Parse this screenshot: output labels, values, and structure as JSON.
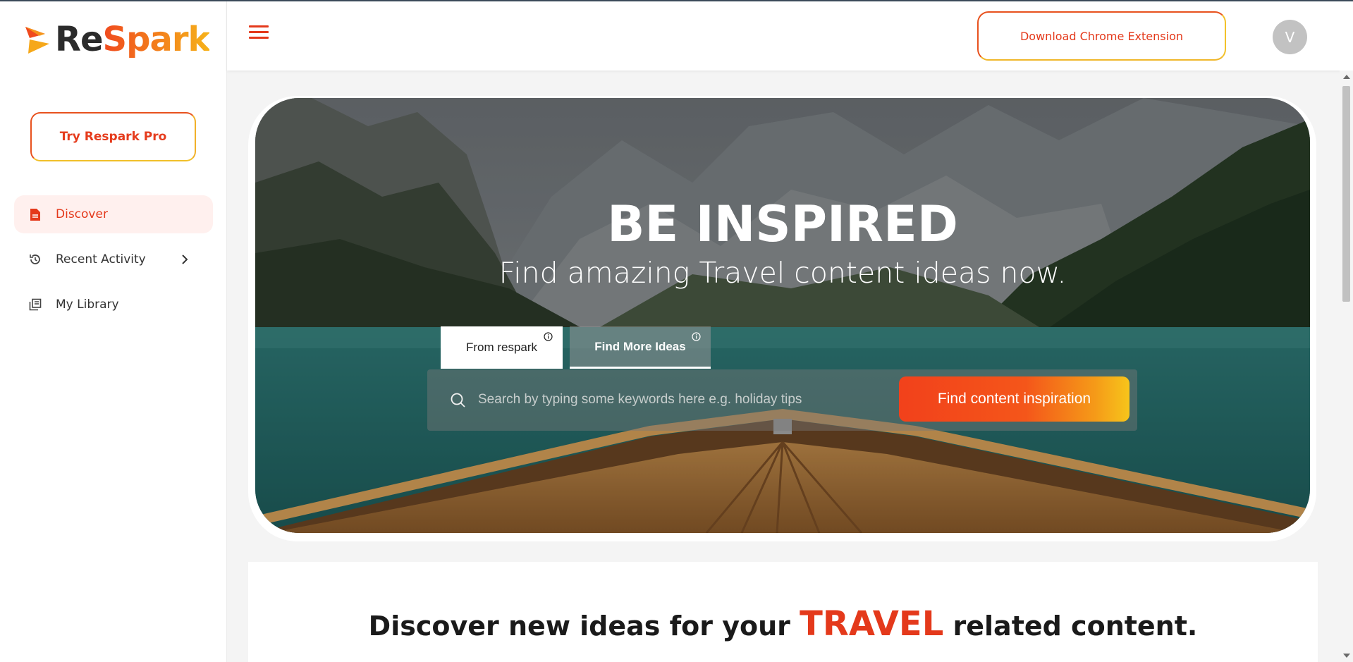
{
  "app": {
    "logo_re": "Re",
    "logo_spark": "Spark",
    "brand_colors": {
      "primary": "#e4391b",
      "accent": "#f6b21a",
      "active_bg": "#fff0ee"
    }
  },
  "sidebar": {
    "pro_button": "Try Respark Pro",
    "items": [
      {
        "label": "Discover",
        "icon": "document-icon",
        "active": true
      },
      {
        "label": "Recent Activity",
        "icon": "history-icon",
        "has_submenu": true
      },
      {
        "label": "My Library",
        "icon": "library-icon"
      }
    ]
  },
  "header": {
    "menu_icon": "hamburger-icon",
    "download_button": "Download Chrome Extension",
    "avatar_initial": "V"
  },
  "hero": {
    "title": "BE INSPIRED",
    "subtitle": "Find amazing Travel content ideas now.",
    "tabs": [
      {
        "label": "From respark",
        "active": true
      },
      {
        "label": "Find More Ideas",
        "active": false
      }
    ],
    "search": {
      "placeholder": "Search by typing some keywords here e.g. holiday tips",
      "value": ""
    },
    "cta": "Find content inspiration"
  },
  "discover": {
    "heading_before": "Discover new ideas for your ",
    "heading_highlight": "TRAVEL",
    "heading_after": " related content."
  }
}
